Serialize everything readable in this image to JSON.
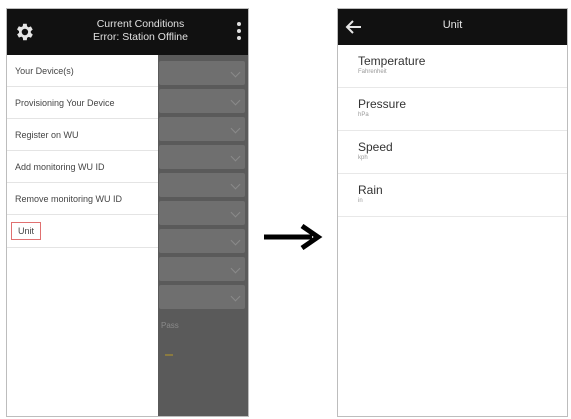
{
  "left_screen": {
    "header": {
      "title_line1": "Current Conditions",
      "title_line2": "Error: Station Offline",
      "settings_icon": "gear-icon",
      "more_icon": "kebab-menu-icon"
    },
    "menu": {
      "items": [
        {
          "label": "Your Device(s)"
        },
        {
          "label": "Provisioning Your Device"
        },
        {
          "label": "Register on WU"
        },
        {
          "label": "Add monitoring WU ID"
        },
        {
          "label": "Remove monitoring WU ID"
        },
        {
          "label": "Unit"
        }
      ],
      "selected": "Unit"
    },
    "background_text": "Pass"
  },
  "transition_arrow_icon": "right-arrow-icon",
  "right_screen": {
    "header": {
      "title": "Unit",
      "back_icon": "back-arrow-icon"
    },
    "units": [
      {
        "label": "Temperature",
        "value": "Fahrenheit"
      },
      {
        "label": "Pressure",
        "value": "hPa"
      },
      {
        "label": "Speed",
        "value": "kph"
      },
      {
        "label": "Rain",
        "value": "in"
      }
    ]
  },
  "colors": {
    "topbar": "#111111",
    "overlay": "#5a5a5a",
    "selected_border": "#e07070"
  }
}
